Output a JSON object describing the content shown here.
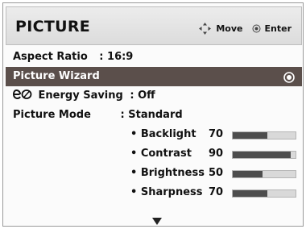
{
  "header": {
    "title": "PICTURE",
    "move_label": "Move",
    "enter_label": "Enter"
  },
  "menu": {
    "aspect_ratio": {
      "label": "Aspect Ratio",
      "value": ": 16:9"
    },
    "picture_wizard": {
      "label": "Picture Wizard"
    },
    "energy_saving": {
      "label": "Energy Saving",
      "value": ": Off"
    },
    "picture_mode": {
      "label": "Picture Mode",
      "value": ": Standard"
    },
    "settings": [
      {
        "label": "• Backlight",
        "value": "70",
        "level": 0.55
      },
      {
        "label": "• Contrast",
        "value": "90",
        "level": 0.92
      },
      {
        "label": "• Brightness",
        "value": "50",
        "level": 0.47
      },
      {
        "label": "• Sharpness",
        "value": "70",
        "level": 0.55
      }
    ]
  },
  "colors": {
    "selected_bg": "#5b4f4b",
    "bar_fill": "#4d4d4d",
    "bar_track": "#d9d9d9"
  },
  "icons": [
    "move-arrows-icon",
    "enter-circle-icon",
    "radio-selected-icon",
    "energy-saving-eco-icon",
    "scroll-down-arrow-icon"
  ]
}
